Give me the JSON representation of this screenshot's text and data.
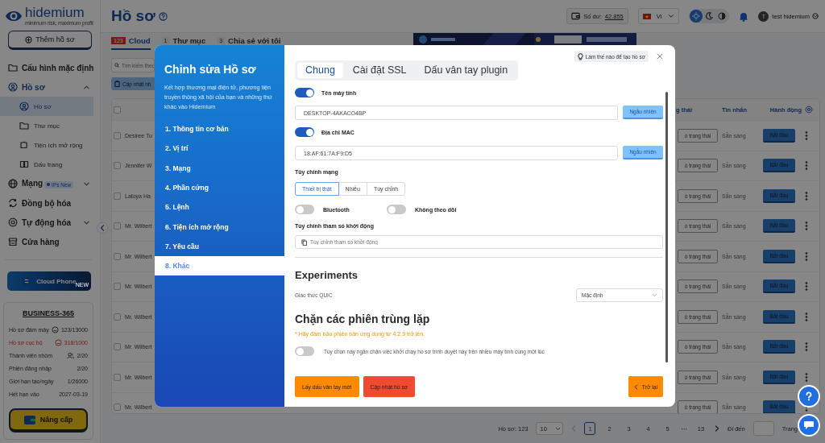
{
  "sidebar": {
    "logo": "hidemium",
    "tagline": "minimum risk, maximum profit",
    "add_button": "Thêm hồ sơ",
    "items": [
      {
        "label": "Cấu hình mặc định",
        "selected": false
      },
      {
        "label": "Hồ sơ",
        "selected": false,
        "expanded": true,
        "children": [
          {
            "label": "Hồ sơ",
            "selected": true
          },
          {
            "label": "Thư mục",
            "selected": false
          },
          {
            "label": "Tiện ích mở rộng",
            "selected": false
          },
          {
            "label": "Dấu trang",
            "selected": false
          }
        ]
      },
      {
        "label": "Mạng",
        "selected": false,
        "expanded": false,
        "badge": "IPs New"
      },
      {
        "label": "Đồng bộ hóa",
        "selected": false
      },
      {
        "label": "Tự động hóa",
        "selected": false,
        "expanded": false
      },
      {
        "label": "Cửa hàng",
        "selected": false
      }
    ],
    "cloud_phone": {
      "label": "Cloud Phone",
      "badge": "NEW"
    },
    "plan": {
      "title": "BUSINESS-365",
      "rows": [
        {
          "label": "Hồ sơ đám mây",
          "value": "123/13000",
          "warning": false
        },
        {
          "label": "Hồ sơ cục bộ",
          "value": "318/1000",
          "warning": true
        },
        {
          "label": "Thành viên nhóm",
          "value": "2/20",
          "warning": false
        },
        {
          "label": "Phiên đăng nhập",
          "value": "2/20",
          "warning": false
        },
        {
          "label": "Giới hạn tạo/ngày",
          "value": "1/26000",
          "warning": false
        },
        {
          "label": "Hết hạn vào",
          "value": "2027-03-19",
          "warning": false
        }
      ]
    },
    "upgrade_button": "Nâng cấp"
  },
  "header": {
    "title": "Hồ sơ",
    "balance_label": "Số dư:",
    "balance": "42.855",
    "language": "Vi",
    "theme_modes": [
      {
        "selected": true
      },
      {
        "selected": false
      },
      {
        "selected": false
      }
    ],
    "user_initial": "T",
    "user_name": "test hidemium"
  },
  "tabs": [
    {
      "count": "123",
      "label": "Cloud",
      "selected": true
    },
    {
      "count": "1",
      "label": "Thư mục",
      "selected": false
    },
    {
      "count": "3",
      "label": "Chia sẻ với tôi",
      "selected": false
    }
  ],
  "search": {
    "placeholder": "Tìm kiếm theo"
  },
  "update_button": "Cập nhật nh",
  "table": {
    "all_checked": false,
    "columns": [
      "g thái",
      "Tin nhắn",
      "Hành động"
    ],
    "rows": [
      {
        "name": "Desiree Tu",
        "status": "ó trạng thái",
        "message": "Sẵn sàng",
        "action": "Bắt đầu",
        "checked": false
      },
      {
        "name": "Jennifer W",
        "status": "ó trạng thái",
        "message": "Sẵn sàng",
        "action": "Bắt đầu",
        "checked": false
      },
      {
        "name": "Latoya Ha",
        "status": "ó trạng thái",
        "message": "Sẵn sàng",
        "action": "Bắt đầu",
        "checked": false
      },
      {
        "name": "Mr. Wilbert",
        "status": "ó trạng thái",
        "message": "Sẵn sàng",
        "action": "Bắt đầu",
        "checked": false
      },
      {
        "name": "Mr. Wilbert",
        "status": "ó trạng thái",
        "message": "Sẵn sàng",
        "action": "Bắt đầu",
        "checked": false
      },
      {
        "name": "Mr. Wilbert",
        "status": "ó trạng thái",
        "message": "Sẵn sàng",
        "action": "Bắt đầu",
        "checked": false
      },
      {
        "name": "Mr. Wilbert",
        "status": "ó trạng thái",
        "message": "Sẵn sàng",
        "action": "Bắt đầu",
        "checked": false
      },
      {
        "name": "Mr. Wilbert",
        "status": "ó trạng thái",
        "message": "Sẵn sàng",
        "action": "Bắt đầu",
        "checked": false
      },
      {
        "name": "Mr. Wilbert",
        "status": "ó trạng thái",
        "message": "Sẵn sàng",
        "action": "Bắt đầu",
        "checked": false
      },
      {
        "name": "Mr. Wilbert",
        "status": "ó trạng thái",
        "message": "Sẵn sàng",
        "action": "Bắt đầu",
        "checked": false
      }
    ]
  },
  "pagination": {
    "total": "Hồ sơ: 123",
    "page_size": "10",
    "pages": [
      {
        "label": "1",
        "selected": true
      },
      {
        "label": "2",
        "selected": false
      },
      {
        "label": "3",
        "selected": false
      },
      {
        "label": "4",
        "selected": false
      },
      {
        "label": "5",
        "selected": false
      },
      {
        "label": "13",
        "selected": false
      }
    ],
    "ellipsis": "···",
    "goto_label": "Đi đến",
    "page_label": "Trang"
  },
  "modal": {
    "title": "Chỉnh sửa Hồ sơ",
    "description": "Kết hợp thương mại điện tử, phương tiện truyền thông xã hội của bạn và những thứ khác vào Hidemium",
    "steps": [
      {
        "label": "1. Thông tin cơ bản",
        "selected": false
      },
      {
        "label": "2. Vị trí",
        "selected": false
      },
      {
        "label": "3. Mạng",
        "selected": false
      },
      {
        "label": "4. Phần cứng",
        "selected": false
      },
      {
        "label": "5. Lệnh",
        "selected": false
      },
      {
        "label": "6. Tiện ích mở rộng",
        "selected": false
      },
      {
        "label": "7. Yêu cầu",
        "selected": false
      },
      {
        "label": "8. Khác",
        "selected": true
      }
    ],
    "tabs": [
      {
        "label": "Chung",
        "selected": true
      },
      {
        "label": "Cài đặt SSL",
        "selected": false
      },
      {
        "label": "Dấu vân tay plugin",
        "selected": false
      }
    ],
    "help_link": "Làm thế nào để tạo hồ sơ",
    "computer_name": {
      "label": "Tên máy tính",
      "on": true,
      "value": "DESKTOP-4AKACO4BP",
      "button": "Ngẫu nhiên"
    },
    "mac_address": {
      "label": "Địa chỉ MAC",
      "on": true,
      "value": "18:AF:61:7A:F9:D5",
      "button": "Ngẫu nhiên"
    },
    "network": {
      "label": "Tùy chỉnh mạng",
      "options": [
        {
          "label": "Thiết bị thật",
          "selected": true
        },
        {
          "label": "Nhiễu",
          "selected": false
        },
        {
          "label": "Tùy chỉnh",
          "selected": false
        }
      ]
    },
    "switches": [
      {
        "label": "Bluetooth",
        "on": false
      },
      {
        "label": "Không theo dõi",
        "on": false
      }
    ],
    "launch_args": {
      "label": "Tùy chỉnh tham số khởi động",
      "placeholder": "Tùy chỉnh tham số khởi động"
    },
    "experiments": {
      "heading": "Experiments",
      "label": "Giao thức QUIC",
      "value": "Mặc định"
    },
    "duplicates": {
      "heading": "Chặn các phiên trùng lặp",
      "note": "* Hãy đảm bảo phiên bản ứng dụng từ 4.2.9 trở lên.",
      "label": "Tùy chọn này ngăn chặn việc khởi chạy hồ sơ trình duyệt này trên nhiều máy tính cùng một lúc",
      "on": false
    },
    "fingerprint_button": "Lấy dấu vân tay mới",
    "update_button": "Cập nhật hồ sơ",
    "back_button": "Trở lại"
  }
}
